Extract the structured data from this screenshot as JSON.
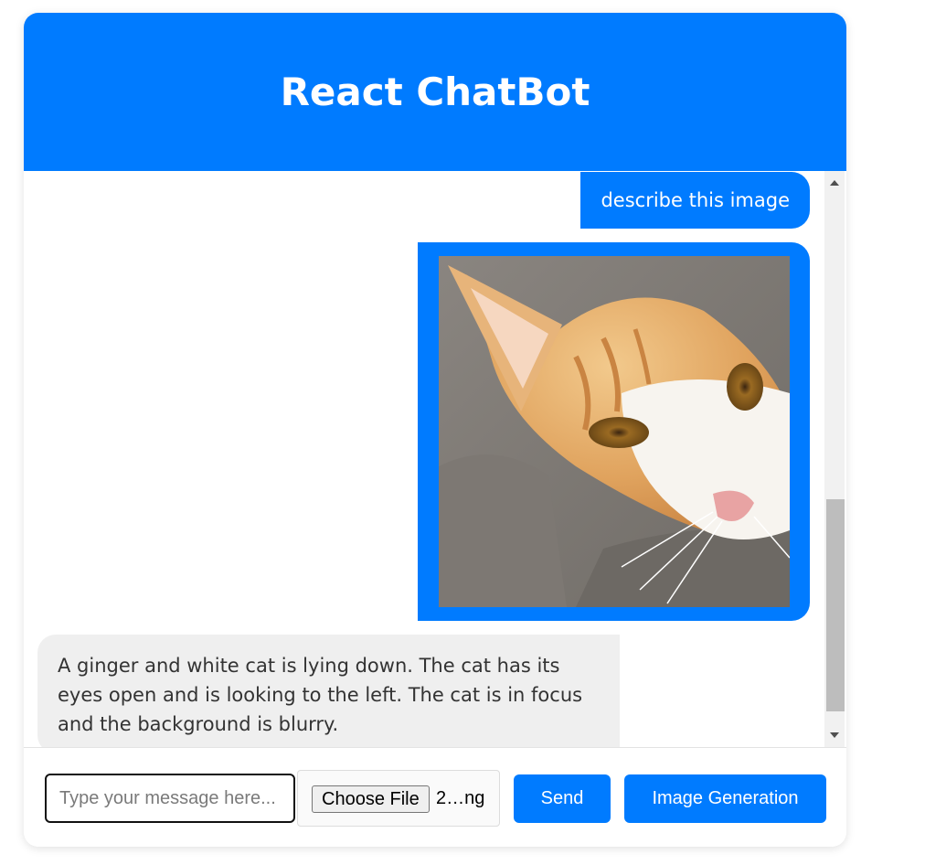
{
  "header": {
    "title": "React ChatBot"
  },
  "messages": [
    {
      "role": "user",
      "type": "text",
      "text": "describe this image"
    },
    {
      "role": "user",
      "type": "image",
      "image": "ginger-white-cat-photo"
    },
    {
      "role": "bot",
      "type": "text",
      "text": "A ginger and white cat is lying down. The cat has its eyes open and is looking to the left. The cat is in focus and the background is blurry."
    }
  ],
  "input": {
    "placeholder": "Type your message here...",
    "value": ""
  },
  "file_input": {
    "button_label": "Choose File",
    "file_name": "2…ng"
  },
  "buttons": {
    "send": "Send",
    "image_generation": "Image Generation"
  },
  "colors": {
    "accent": "#007bff",
    "bot_bubble": "#efefef"
  }
}
